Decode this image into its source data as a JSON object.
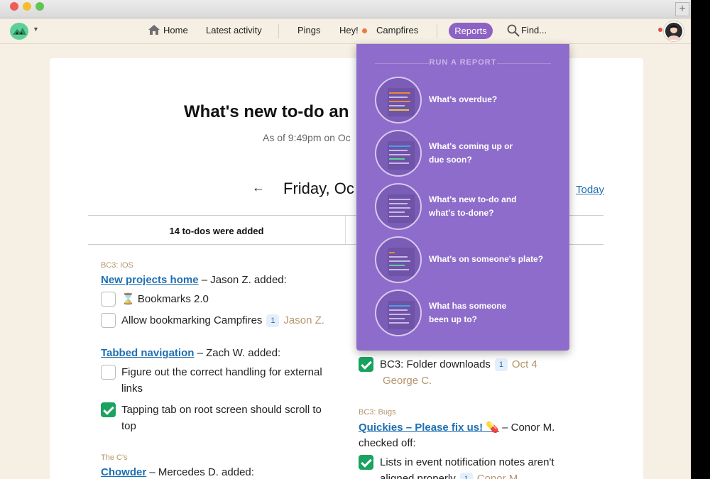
{
  "nav": {
    "home": "Home",
    "latest_activity": "Latest activity",
    "pings": "Pings",
    "hey": "Hey!",
    "campfires": "Campfires",
    "reports": "Reports",
    "find": "Find..."
  },
  "page": {
    "title": "What's new to-do an",
    "subtitle": "As of 9:49pm on Oc",
    "back": "←",
    "date": "Friday, Oc",
    "today": "Today",
    "left_column_heading": "14 to-dos were added"
  },
  "left_groups": [
    {
      "project": "BC3: iOS",
      "list": "New projects home",
      "by": " – Jason Z. added:",
      "items": [
        {
          "text": "⌛ Bookmarks 2.0",
          "checked": false
        },
        {
          "text": "Allow bookmarking Campfires",
          "badge": "1",
          "assignee": "Jason Z.",
          "checked": false
        }
      ]
    },
    {
      "list": "Tabbed navigation",
      "by": " – Zach W. added:",
      "items": [
        {
          "text": "Figure out the correct handling for external",
          "text2": "links",
          "checked": false
        },
        {
          "text": "Tapping tab on root screen should scroll to",
          "text2": "top",
          "checked": true
        }
      ]
    },
    {
      "project": "The C's",
      "list": "Chowder",
      "by": " – Mercedes D. added:"
    }
  ],
  "right_groups": [
    {
      "items": [
        {
          "text": "BC3: Folder downloads",
          "badge": "1",
          "assignee": "Oct 4",
          "text2": "George C.",
          "checked": true
        }
      ]
    },
    {
      "project": "BC3: Bugs",
      "list": "Quickies – Please fix us! 💊",
      "by": " – Conor M.",
      "by2": "checked off:",
      "items": [
        {
          "text": "Lists in event notification notes aren't",
          "text2": "aligned properly",
          "badge": "1",
          "assignee": "Conor M.",
          "checked": true
        }
      ]
    }
  ],
  "reports_menu": {
    "heading": "RUN A REPORT",
    "items": [
      {
        "line1": "What's overdue?",
        "line2": ""
      },
      {
        "line1": "What's coming up or",
        "line2": "due soon?"
      },
      {
        "line1": "What's new to-do and",
        "line2": "what's to-done?"
      },
      {
        "line1": "What's on someone's plate?",
        "line2": ""
      },
      {
        "line1": "What has someone",
        "line2": "been up to?"
      }
    ]
  },
  "colors": {
    "accent_purple": "#8e6ccb",
    "link_blue": "#1f6fb3",
    "check_green": "#1aa260",
    "project_tan": "#b5956b",
    "background": "#f6efe3"
  },
  "icons": [
    "home-icon",
    "search-icon",
    "logo-icon",
    "avatar-icon",
    "arrow-left-icon",
    "checkbox-icon",
    "hourglass-icon",
    "pill-icon"
  ]
}
